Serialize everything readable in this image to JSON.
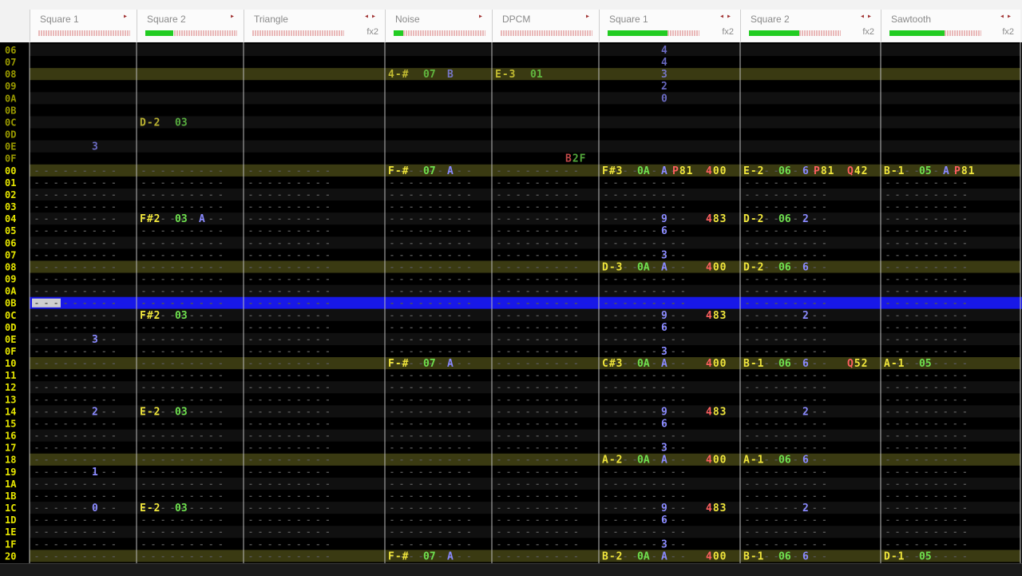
{
  "channels": [
    {
      "name": "Square 1",
      "has_fx2": false,
      "volume": 0.0
    },
    {
      "name": "Square 2",
      "has_fx2": false,
      "volume": 0.3
    },
    {
      "name": "Triangle",
      "has_fx2": true,
      "volume": 0.0
    },
    {
      "name": "Noise",
      "has_fx2": false,
      "volume": 0.1
    },
    {
      "name": "DPCM",
      "has_fx2": false,
      "volume": 0.0
    },
    {
      "name": "Square 1",
      "has_fx2": true,
      "volume": 0.65
    },
    {
      "name": "Square 2",
      "has_fx2": true,
      "volume": 0.55
    },
    {
      "name": "Sawtooth",
      "has_fx2": true,
      "volume": 0.6
    }
  ],
  "fx2_label": "fx2",
  "prev_row_labels": [
    "06",
    "07",
    "08",
    "09",
    "0A",
    "0B",
    "0C",
    "0D",
    "0E",
    "0F"
  ],
  "row_labels": [
    "00",
    "01",
    "02",
    "03",
    "04",
    "05",
    "06",
    "07",
    "08",
    "09",
    "0A",
    "0B",
    "0C",
    "0D",
    "0E",
    "0F",
    "10",
    "11",
    "12",
    "13",
    "14",
    "15",
    "16",
    "17",
    "18",
    "19",
    "1A",
    "1B",
    "1C",
    "1D",
    "1E",
    "1F",
    "20"
  ],
  "cursor_row": "0B",
  "colors": {
    "note": "#f0e63c",
    "instrument": "#6fe04f",
    "volume": "#8a8aff",
    "effect": "#ff6060",
    "row_label": "#e6e600",
    "highlight_row": "#3a3a12",
    "cursor": "#1818e8",
    "dash": "#555555"
  },
  "prev_cells": [
    {
      "row": "06",
      "ch": 5,
      "vol": "4"
    },
    {
      "row": "07",
      "ch": 5,
      "vol": "4"
    },
    {
      "row": "08",
      "ch": 3,
      "note": "4-#",
      "inst": "07",
      "vol": "B"
    },
    {
      "row": "08",
      "ch": 4,
      "note": "E-3",
      "inst": "01"
    },
    {
      "row": "08",
      "ch": 5,
      "vol": "3"
    },
    {
      "row": "09",
      "ch": 5,
      "vol": "2"
    },
    {
      "row": "0A",
      "ch": 5,
      "vol": "0"
    },
    {
      "row": "0C",
      "ch": 1,
      "note": "D-2",
      "inst": "03"
    },
    {
      "row": "0E",
      "ch": 0,
      "vol": "3"
    },
    {
      "row": "0F",
      "ch": 4,
      "fx": "B2F"
    }
  ],
  "cells": [
    {
      "row": "00",
      "ch": 3,
      "note": "F-#",
      "inst": "07",
      "vol": "A"
    },
    {
      "row": "00",
      "ch": 5,
      "note": "F#3",
      "inst": "0A",
      "vol": "A",
      "fx": "P81",
      "fx2": "400"
    },
    {
      "row": "00",
      "ch": 6,
      "note": "E-2",
      "inst": "06",
      "vol": "6",
      "fx": "P81",
      "fx2": "Q42"
    },
    {
      "row": "00",
      "ch": 7,
      "note": "B-1",
      "inst": "05",
      "vol": "A",
      "fx": "P81"
    },
    {
      "row": "04",
      "ch": 1,
      "note": "F#2",
      "inst": "03",
      "vol": "A"
    },
    {
      "row": "04",
      "ch": 5,
      "vol": "9",
      "fx2": "483"
    },
    {
      "row": "04",
      "ch": 6,
      "note": "D-2",
      "inst": "06",
      "vol": "2"
    },
    {
      "row": "05",
      "ch": 5,
      "vol": "6"
    },
    {
      "row": "07",
      "ch": 5,
      "vol": "3"
    },
    {
      "row": "08",
      "ch": 5,
      "note": "D-3",
      "inst": "0A",
      "vol": "A",
      "fx2": "400"
    },
    {
      "row": "08",
      "ch": 6,
      "note": "D-2",
      "inst": "06",
      "vol": "6"
    },
    {
      "row": "0C",
      "ch": 1,
      "note": "F#2",
      "inst": "03"
    },
    {
      "row": "0C",
      "ch": 5,
      "vol": "9",
      "fx2": "483"
    },
    {
      "row": "0C",
      "ch": 6,
      "vol": "2"
    },
    {
      "row": "0D",
      "ch": 5,
      "vol": "6"
    },
    {
      "row": "0E",
      "ch": 0,
      "vol": "3"
    },
    {
      "row": "0F",
      "ch": 5,
      "vol": "3"
    },
    {
      "row": "10",
      "ch": 3,
      "note": "F-#",
      "inst": "07",
      "vol": "A"
    },
    {
      "row": "10",
      "ch": 5,
      "note": "C#3",
      "inst": "0A",
      "vol": "A",
      "fx2": "400"
    },
    {
      "row": "10",
      "ch": 6,
      "note": "B-1",
      "inst": "06",
      "vol": "6",
      "fx2": "Q52"
    },
    {
      "row": "10",
      "ch": 7,
      "note": "A-1",
      "inst": "05"
    },
    {
      "row": "14",
      "ch": 0,
      "vol": "2"
    },
    {
      "row": "14",
      "ch": 1,
      "note": "E-2",
      "inst": "03"
    },
    {
      "row": "14",
      "ch": 5,
      "vol": "9",
      "fx2": "483"
    },
    {
      "row": "14",
      "ch": 6,
      "vol": "2"
    },
    {
      "row": "15",
      "ch": 5,
      "vol": "6"
    },
    {
      "row": "17",
      "ch": 5,
      "vol": "3"
    },
    {
      "row": "18",
      "ch": 5,
      "note": "A-2",
      "inst": "0A",
      "vol": "A",
      "fx2": "400"
    },
    {
      "row": "18",
      "ch": 6,
      "note": "A-1",
      "inst": "06",
      "vol": "6"
    },
    {
      "row": "19",
      "ch": 0,
      "vol": "1"
    },
    {
      "row": "1C",
      "ch": 0,
      "vol": "0"
    },
    {
      "row": "1C",
      "ch": 1,
      "note": "E-2",
      "inst": "03"
    },
    {
      "row": "1C",
      "ch": 5,
      "vol": "9",
      "fx2": "483"
    },
    {
      "row": "1C",
      "ch": 6,
      "vol": "2"
    },
    {
      "row": "1D",
      "ch": 5,
      "vol": "6"
    },
    {
      "row": "1F",
      "ch": 5,
      "vol": "3"
    },
    {
      "row": "20",
      "ch": 3,
      "note": "F-#",
      "inst": "07",
      "vol": "A"
    },
    {
      "row": "20",
      "ch": 5,
      "note": "B-2",
      "inst": "0A",
      "vol": "A",
      "fx2": "400"
    },
    {
      "row": "20",
      "ch": 6,
      "note": "B-1",
      "inst": "06",
      "vol": "6"
    },
    {
      "row": "20",
      "ch": 7,
      "note": "D-1",
      "inst": "05"
    }
  ]
}
